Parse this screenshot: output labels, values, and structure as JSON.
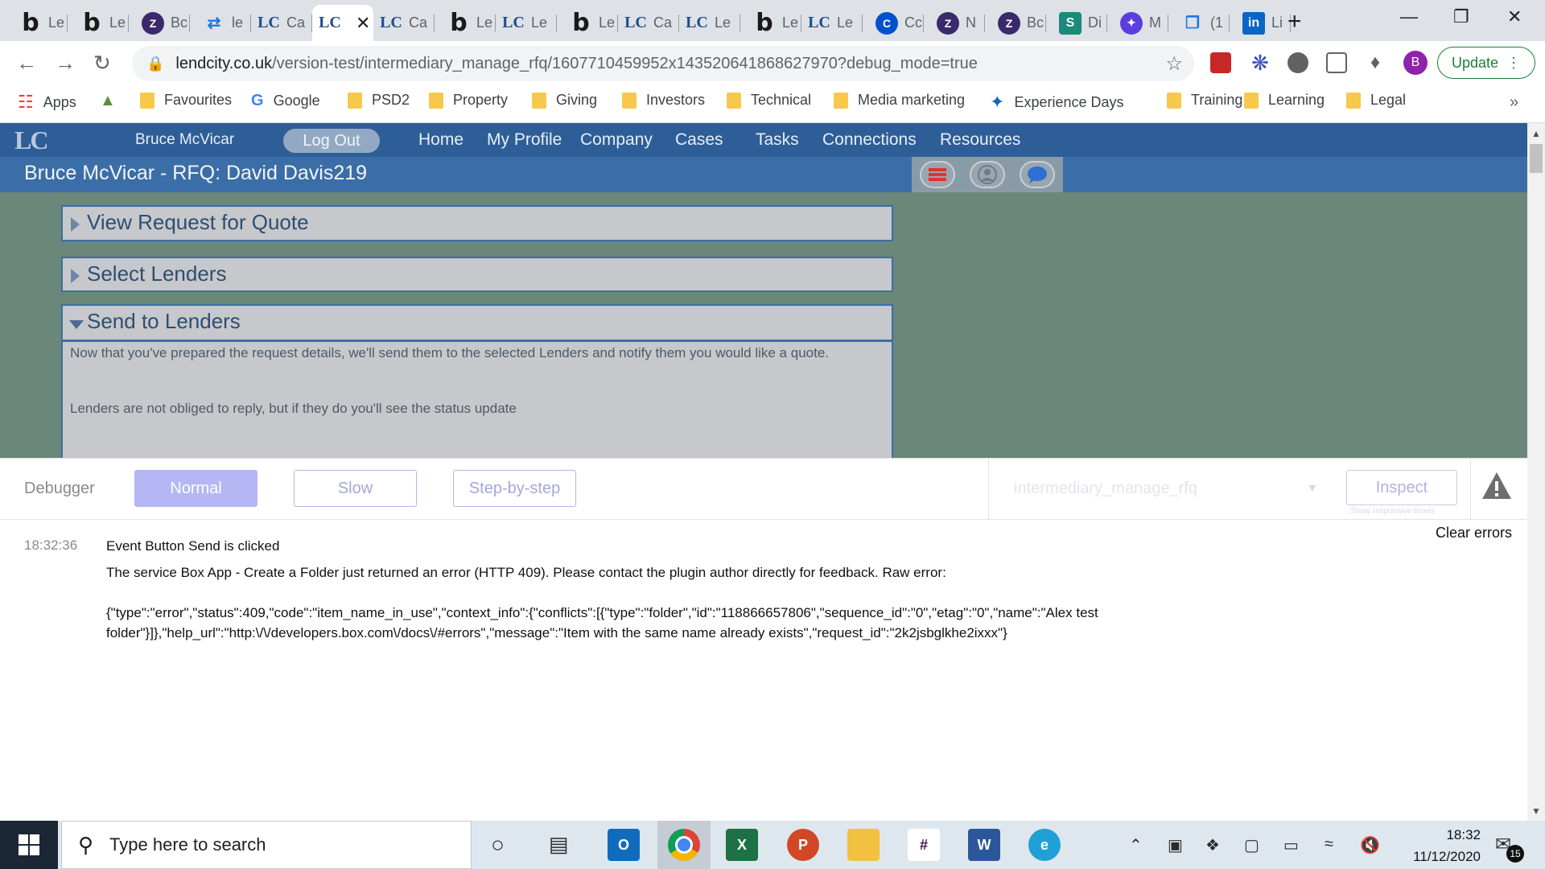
{
  "browser": {
    "tabs": [
      {
        "label": "Le",
        "favicon": "bubble-b"
      },
      {
        "label": "Le",
        "favicon": "bubble-b"
      },
      {
        "label": "Bc",
        "favicon": "zoho"
      },
      {
        "label": "le",
        "favicon": "link"
      },
      {
        "label": "Ca",
        "favicon": "lc"
      },
      {
        "label": "",
        "favicon": "lc",
        "active": true
      },
      {
        "label": "Ca",
        "favicon": "lc"
      },
      {
        "label": "Le",
        "favicon": "bubble-b"
      },
      {
        "label": "Le",
        "favicon": "lc"
      },
      {
        "label": "Le",
        "favicon": "bubble-b"
      },
      {
        "label": "Ca",
        "favicon": "lc"
      },
      {
        "label": "Le",
        "favicon": "lc"
      },
      {
        "label": "Le",
        "favicon": "bubble-b"
      },
      {
        "label": "Le",
        "favicon": "lc"
      },
      {
        "label": "Cc",
        "favicon": "confluence"
      },
      {
        "label": "N",
        "favicon": "zoho"
      },
      {
        "label": "Bc",
        "favicon": "zoho"
      },
      {
        "label": "Di",
        "favicon": "app-green"
      },
      {
        "label": "M",
        "favicon": "app-purple"
      },
      {
        "label": "(1",
        "favicon": "teams"
      },
      {
        "label": "Li",
        "favicon": "linkedin"
      }
    ],
    "url_host": "lendcity.co.uk",
    "url_path": "/version-test/intermediary_manage_rfq/1607710459952x143520641868627970?debug_mode=true",
    "update_label": "Update",
    "profile_initial": "B",
    "bookmarks": [
      {
        "label": "Apps",
        "icon": "apps-grid-icon"
      },
      {
        "label": "",
        "icon": "shopify-icon"
      },
      {
        "label": "Favourites",
        "icon": "folder-icon"
      },
      {
        "label": "Google",
        "icon": "google-icon"
      },
      {
        "label": "PSD2",
        "icon": "folder-icon"
      },
      {
        "label": "Property",
        "icon": "folder-icon"
      },
      {
        "label": "Giving",
        "icon": "folder-icon"
      },
      {
        "label": "Investors",
        "icon": "folder-icon"
      },
      {
        "label": "Technical",
        "icon": "folder-icon"
      },
      {
        "label": "Media marketing",
        "icon": "folder-icon"
      },
      {
        "label": "Experience Days",
        "icon": "experience-icon"
      },
      {
        "label": "Training",
        "icon": "folder-icon"
      },
      {
        "label": "Learning",
        "icon": "folder-icon"
      },
      {
        "label": "Legal",
        "icon": "folder-icon"
      }
    ]
  },
  "app": {
    "logo": "LC",
    "username": "Bruce McVicar",
    "logout_label": "Log Out",
    "nav": [
      "Home",
      "My Profile",
      "Company",
      "Cases",
      "Tasks",
      "Connections",
      "Resources"
    ],
    "page_title": "Bruce McVicar -  RFQ: David Davis219",
    "sections": [
      {
        "title": "View Request for Quote",
        "expanded": false
      },
      {
        "title": "Select Lenders",
        "expanded": false
      },
      {
        "title": "Send to Lenders",
        "expanded": true
      }
    ],
    "send_text_1": "Now that you've prepared the request details, we'll send them to the selected Lenders and notify them you would like a quote.",
    "send_text_2": "Lenders are not obliged to reply, but if they do you'll see the status  update"
  },
  "debugger": {
    "label": "Debugger",
    "modes": [
      "Normal",
      "Slow",
      "Step-by-step"
    ],
    "active_mode": "Normal",
    "page_select": "intermediary_manage_rfq",
    "inspect_label": "Inspect",
    "inspect_note": "Show responsive boxes",
    "clear_label": "Clear errors",
    "log_time": "18:32:36",
    "log_event": "Event Button Send is clicked",
    "log_error": "The service Box App - Create a Folder just returned an error (HTTP 409). Please contact the plugin author directly for feedback. Raw error:",
    "log_raw": "{\"type\":\"error\",\"status\":409,\"code\":\"item_name_in_use\",\"context_info\":{\"conflicts\":[{\"type\":\"folder\",\"id\":\"118866657806\",\"sequence_id\":\"0\",\"etag\":\"0\",\"name\":\"Alex test folder\"}]},\"help_url\":\"http:\\/\\/developers.box.com\\/docs\\/#errors\",\"message\":\"Item with the same name already exists\",\"request_id\":\"2k2jsbglkhe2ixxx\"}"
  },
  "taskbar": {
    "search_placeholder": "Type here to search",
    "time": "18:32",
    "date": "11/12/2020",
    "notification_count": "15"
  }
}
